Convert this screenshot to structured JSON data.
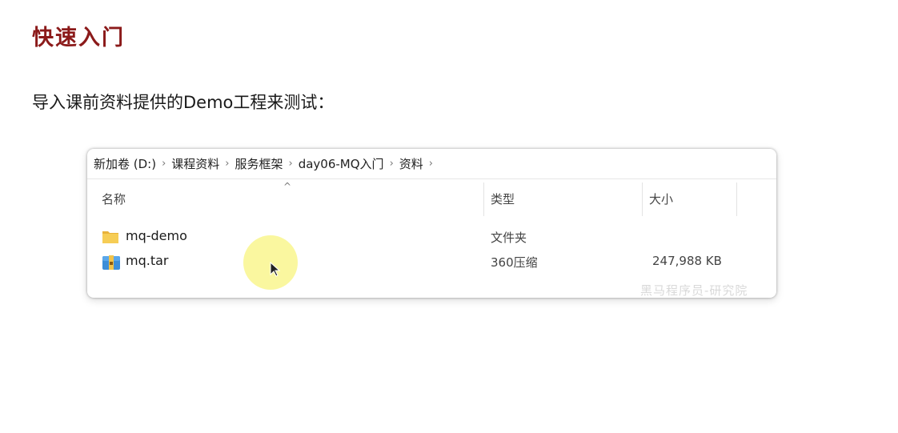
{
  "slide": {
    "title": "快速入门",
    "text": "导入课前资料提供的Demo工程来测试："
  },
  "explorer": {
    "breadcrumb": [
      "新加卷 (D:)",
      "课程资料",
      "服务框架",
      "day06-MQ入门",
      "资料"
    ],
    "separator": "›",
    "columns": {
      "name": "名称",
      "type": "类型",
      "size": "大小"
    },
    "sort_indicator": "^",
    "files": [
      {
        "name": "mq-demo",
        "type": "文件夹",
        "size": "",
        "icon": "folder-icon"
      },
      {
        "name": "mq.tar",
        "type": "360压缩",
        "size": "247,988 KB",
        "icon": "archive-icon"
      }
    ]
  },
  "watermark": "黑马程序员-研究院",
  "colors": {
    "title": "#8b1a1a",
    "folder": "#f3c24b",
    "highlight": "#f6f050"
  }
}
